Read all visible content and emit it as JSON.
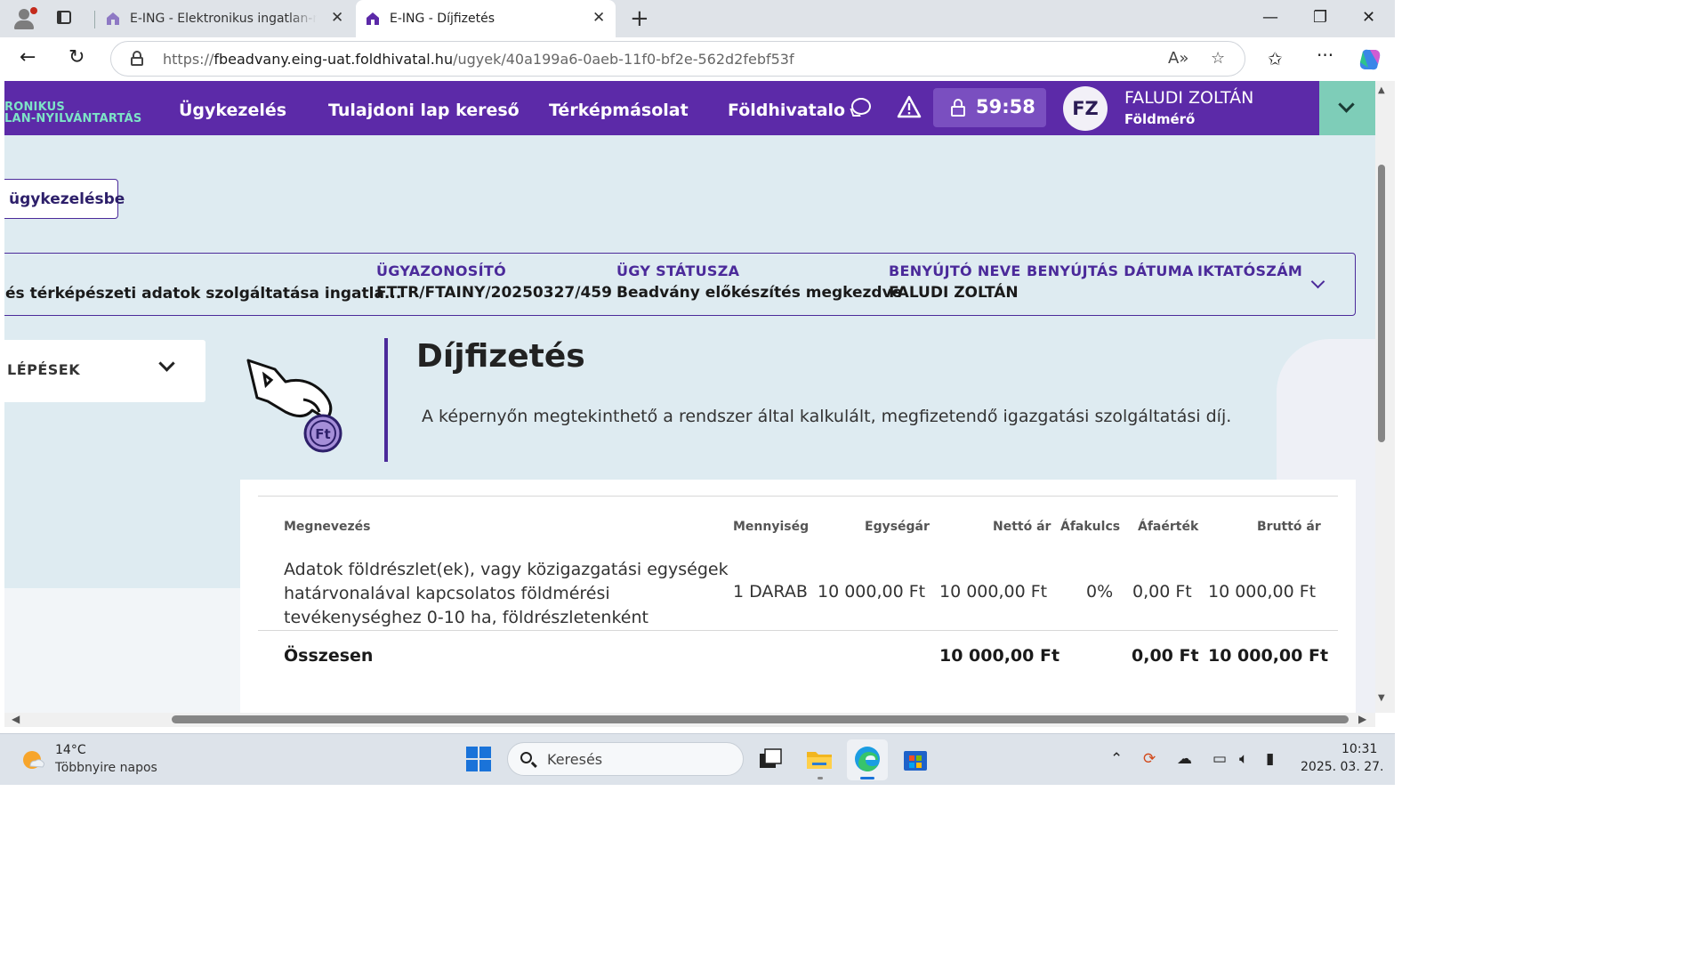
{
  "browser": {
    "tabs": [
      {
        "title": "E-ING - Elektronikus ingatlan-nyilvántartás",
        "active": false
      },
      {
        "title": "E-ING - Díjfizetés",
        "active": true
      }
    ],
    "url": {
      "scheme": "https://",
      "host": "fbeadvany.eing-uat.foldhivatal.hu",
      "path": "/ugyek/40a199a6-0aeb-11f0-bf2e-562d2febf53f"
    }
  },
  "site_nav": {
    "logo_line1": "RONIKUS",
    "logo_line2": "LAN-NYILVÁNTARTÁS",
    "links": [
      "Ügykezelés",
      "Tulajdoni lap kereső",
      "Térképmásolat",
      "Földhivatalo"
    ],
    "timer": "59:58",
    "avatar_initials": "FZ",
    "user_name": "FALUDI ZOLTÁN",
    "user_role": "Földmérő"
  },
  "back_button": "ügykezelésbe",
  "case_header": {
    "service_title": "és térképészeti adatok szolgáltatása ingatla...",
    "columns": [
      {
        "label": "ÜGYAZONOSÍTÓ",
        "value": "FTTR/FTAINY/20250327/459"
      },
      {
        "label": "ÜGY STÁTUSZA",
        "value": "Beadvány előkészítés megkezdve"
      },
      {
        "label": "BENYÚJTÓ NEVE",
        "value": "FALUDI ZOLTÁN"
      },
      {
        "label": "BENYÚJTÁS DÁTUMA",
        "value": ""
      },
      {
        "label": "IKTATÓSZÁM",
        "value": ""
      }
    ]
  },
  "steps_label": "LÉPÉSEK",
  "page": {
    "title": "Díjfizetés",
    "description": "A képernyőn megtekinthető a rendszer által kalkulált, megfizetendő igazgatási szolgáltatási díj.",
    "coin_label": "Ft"
  },
  "fee_table": {
    "headers": [
      "Megnevezés",
      "Mennyiség",
      "Egységár",
      "Nettó ár",
      "Áfakulcs",
      "Áfaérték",
      "Bruttó ár"
    ],
    "rows": [
      {
        "description_lines": [
          "Adatok földrészlet(ek), vagy közigazgatási egységek",
          "határvonalával kapcsolatos földmérési",
          "tevékenységhez 0-10 ha, földrészletenként"
        ],
        "quantity": "1 DARAB",
        "unit_price": "10 000,00 Ft",
        "net": "10 000,00 Ft",
        "vat_rate": "0%",
        "vat_amount": "0,00 Ft",
        "gross": "10 000,00 Ft"
      }
    ],
    "total": {
      "label": "Összesen",
      "net": "10 000,00 Ft",
      "vat_amount": "0,00 Ft",
      "gross": "10 000,00 Ft"
    }
  },
  "taskbar": {
    "weather_temp": "14°C",
    "weather_desc": "Többnyire napos",
    "search_placeholder": "Keresés",
    "time": "10:31",
    "date": "2025. 03. 27."
  },
  "colors": {
    "brand_purple": "#5c2aa8",
    "accent_teal": "#7ecdb8",
    "page_bg": "#deebf1"
  }
}
